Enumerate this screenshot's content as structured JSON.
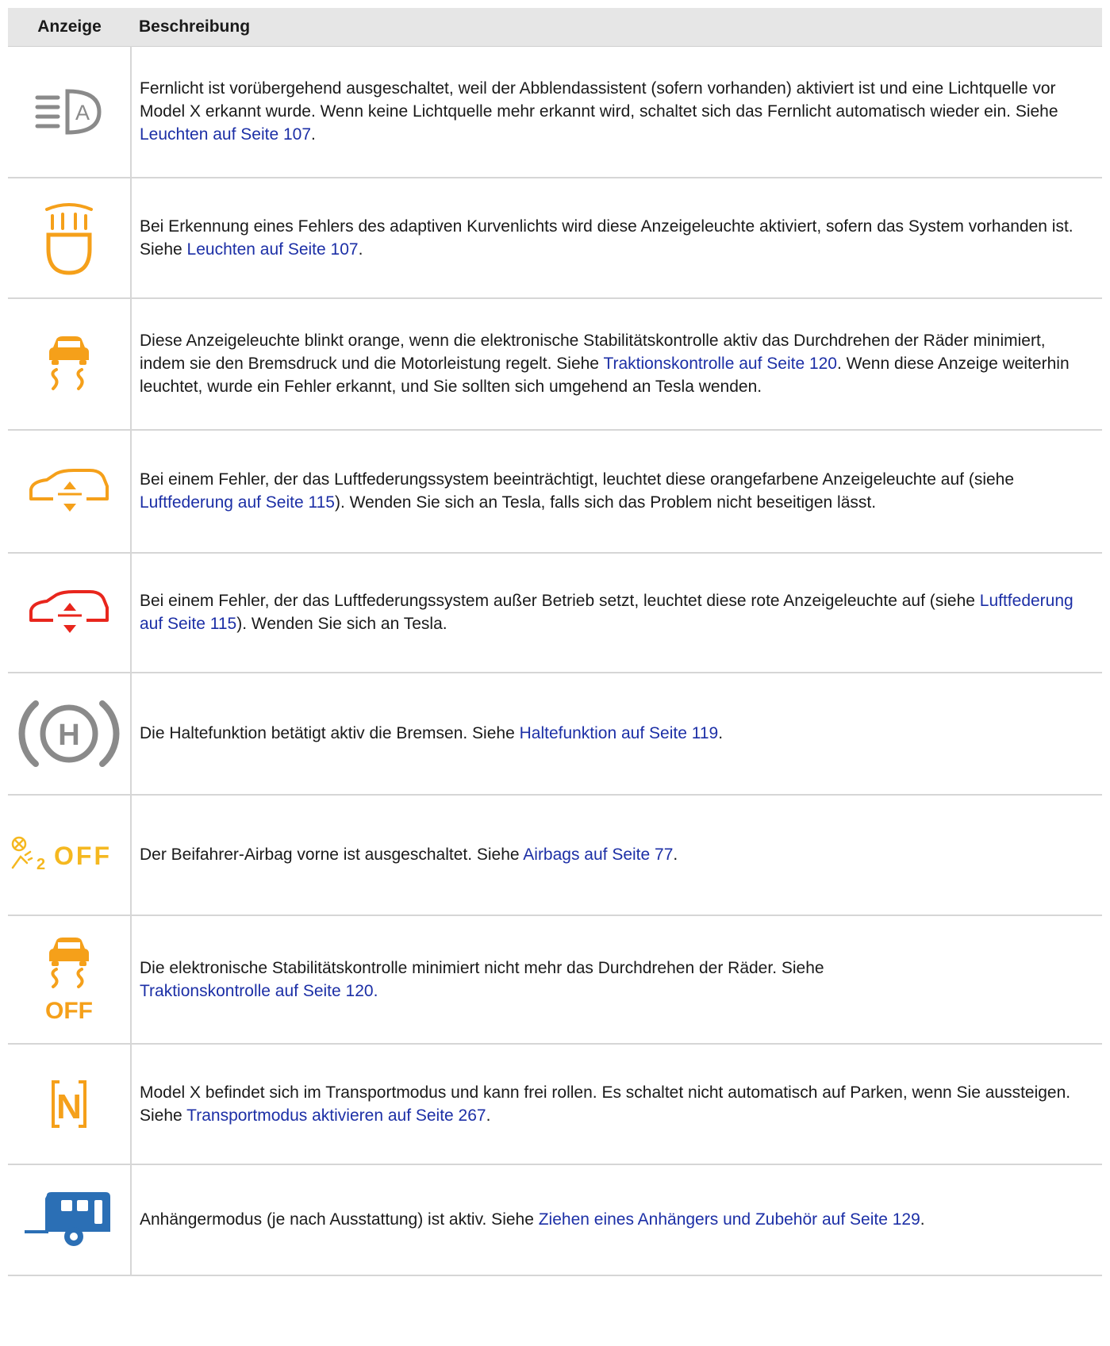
{
  "header": {
    "col_indicator": "Anzeige",
    "col_description": "Beschreibung"
  },
  "rows": [
    {
      "icon": "auto-high-beam-off-icon",
      "text": "Fernlicht ist vorübergehend ausgeschaltet, weil der Abblendassistent (sofern vorhanden) aktiviert ist und eine Lichtquelle vor Model X erkannt wurde. Wenn keine Lichtquelle mehr erkannt wird, schaltet sich das Fernlicht automatisch wieder ein. Siehe ",
      "link": "Leuchten auf Seite 107",
      "after": "."
    },
    {
      "icon": "adaptive-headlight-fault-icon",
      "text": "Bei Erkennung eines Fehlers des adaptiven Kurvenlichts wird diese Anzeigeleuchte aktiviert, sofern das System vorhanden ist. Siehe ",
      "link": "Leuchten auf Seite 107",
      "after": "."
    },
    {
      "icon": "traction-control-icon",
      "text": "Diese Anzeigeleuchte blinkt orange, wenn die elektronische Stabilitätskontrolle aktiv das Durchdrehen der Räder minimiert, indem sie den Bremsdruck und die Motorleistung regelt. Siehe ",
      "link": "Traktionskontrolle auf Seite 120",
      "after": ". Wenn diese Anzeige weiterhin leuchtet, wurde ein Fehler erkannt, und Sie sollten sich umgehend an Tesla wenden."
    },
    {
      "icon": "air-suspension-warning-icon",
      "text": "Bei einem Fehler, der das Luftfederungssystem beeinträchtigt, leuchtet diese orangefarbene Anzeigeleuchte auf (siehe ",
      "link": "Luftfederung auf Seite 115",
      "after": "). Wenden Sie sich an Tesla, falls sich das Problem nicht beseitigen lässt."
    },
    {
      "icon": "air-suspension-fault-icon",
      "text": "Bei einem Fehler, der das Luftfederungssystem außer Betrieb setzt, leuchtet diese rote Anzeigeleuchte auf (siehe ",
      "link": "Luftfederung auf Seite 115",
      "after": "). Wenden Sie sich an Tesla."
    },
    {
      "icon": "vehicle-hold-icon",
      "icon_letter": "H",
      "text": "Die Haltefunktion betätigt aktiv die Bremsen. Siehe ",
      "link": "Haltefunktion auf Seite 119",
      "after": "."
    },
    {
      "icon": "passenger-airbag-off-icon",
      "icon_sub": "2",
      "icon_label": "OFF",
      "text": "Der Beifahrer-Airbag vorne ist ausgeschaltet. Siehe ",
      "link": "Airbags auf Seite 77",
      "after": "."
    },
    {
      "icon": "traction-control-off-icon",
      "icon_label": "OFF",
      "text": "Die elektronische Stabilitätskontrolle minimiert nicht mehr das Durchdrehen der Räder. Siehe ",
      "link": "Traktionskontrolle auf Seite 120",
      "after": "."
    },
    {
      "icon": "transport-mode-icon",
      "icon_letter": "N",
      "text": "Model X befindet sich im Transportmodus und kann frei rollen. Es schaltet nicht automatisch auf Parken, wenn Sie aussteigen. Siehe ",
      "link": "Transportmodus aktivieren auf Seite 267",
      "after": "."
    },
    {
      "icon": "trailer-mode-icon",
      "text": "Anhängermodus (je nach Ausstattung) ist aktiv. Siehe ",
      "link": "Ziehen eines Anhängers und Zubehör auf Seite 129",
      "after": "."
    }
  ],
  "colors": {
    "link": "#1c2fa6",
    "orange": "#f5a01a",
    "red": "#e8261d",
    "gray": "#8a8a8a",
    "blue": "#2b6fb5"
  }
}
